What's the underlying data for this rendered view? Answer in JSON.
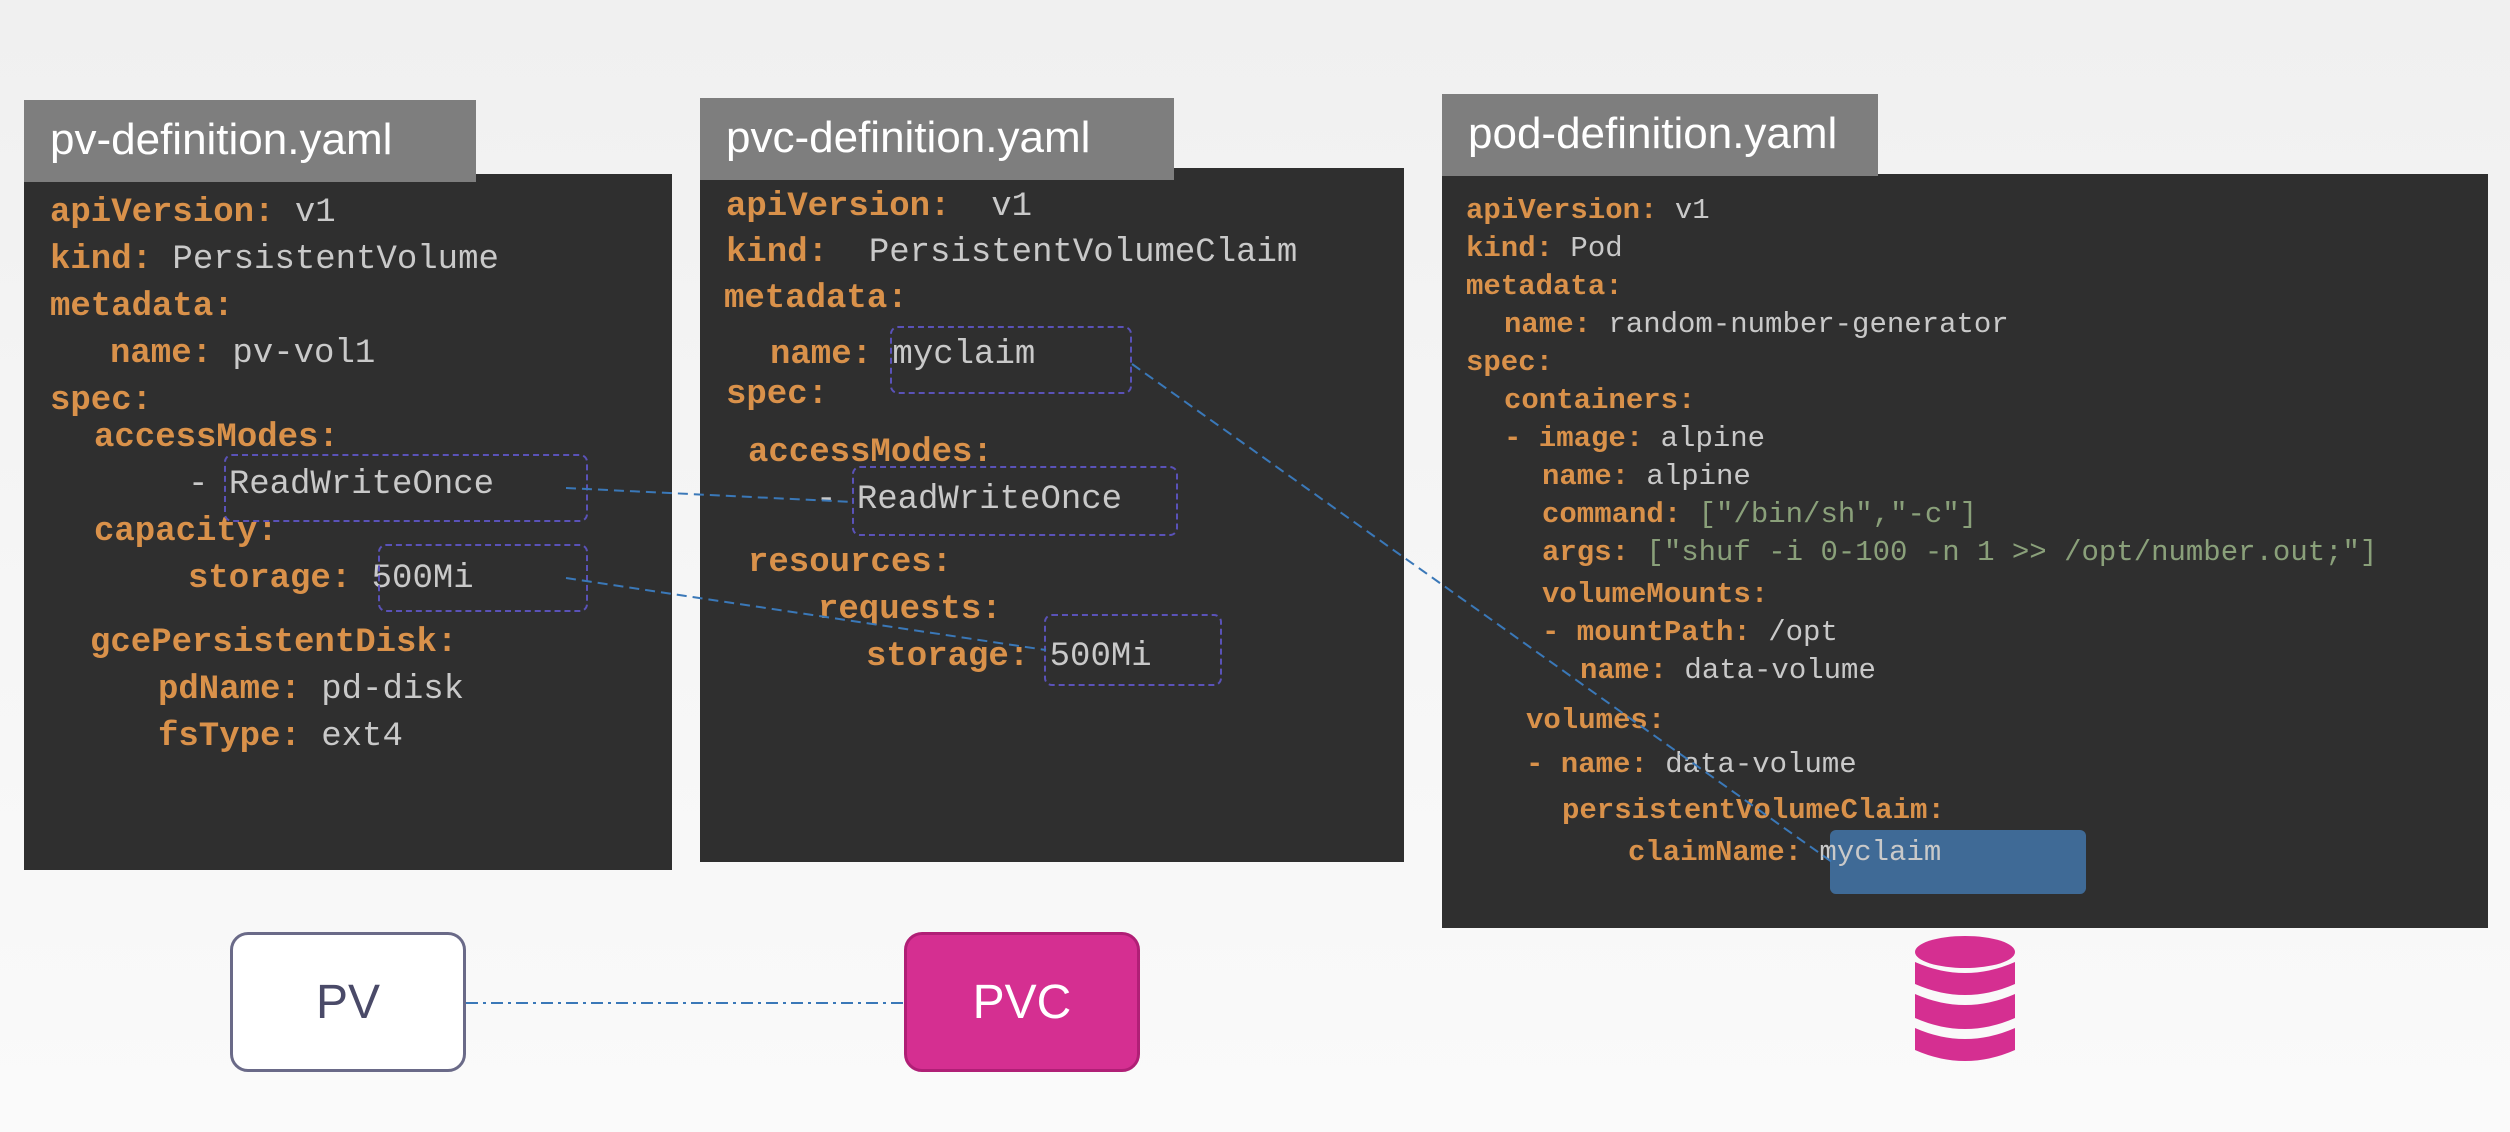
{
  "files": {
    "pv": {
      "title": "pv-definition.yaml",
      "lines": [
        [
          "apiVersion:",
          " v1"
        ],
        [
          "kind:",
          " PersistentVolume"
        ],
        [
          "metadata:",
          ""
        ],
        [
          "name:",
          " pv-vol1"
        ],
        [
          "spec:",
          ""
        ],
        [
          "accessModes:",
          ""
        ],
        [
          "- ",
          "ReadWriteOnce"
        ],
        [
          "capacity:",
          ""
        ],
        [
          "storage:",
          " 500Mi"
        ],
        [
          "gcePersistentDisk:",
          ""
        ],
        [
          "pdName:",
          " pd-disk"
        ],
        [
          "fsType:",
          " ext4"
        ]
      ]
    },
    "pvc": {
      "title": "pvc-definition.yaml",
      "lines": [
        [
          "apiVersion:",
          "  v1"
        ],
        [
          "kind:",
          "  PersistentVolumeClaim"
        ],
        [
          "metadata:",
          ""
        ],
        [
          "name:",
          " myclaim"
        ],
        [
          "spec:",
          ""
        ],
        [
          "accessModes:",
          ""
        ],
        [
          "- ",
          "ReadWriteOnce"
        ],
        [
          "resources:",
          ""
        ],
        [
          "requests:",
          ""
        ],
        [
          "storage:",
          " 500Mi"
        ]
      ]
    },
    "pod": {
      "title": "pod-definition.yaml",
      "lines": [
        [
          "apiVersion:",
          " v1"
        ],
        [
          "kind:",
          " Pod"
        ],
        [
          "metadata:",
          ""
        ],
        [
          "name:",
          " random-number-generator"
        ],
        [
          "spec:",
          ""
        ],
        [
          "containers:",
          ""
        ],
        [
          "- image:",
          " alpine"
        ],
        [
          "name:",
          " alpine"
        ],
        [
          "command:",
          " [\"/bin/sh\",\"-c\"]"
        ],
        [
          "args:",
          " [\"shuf -i 0-100 -n 1 >> /opt/number.out;\"]"
        ],
        [
          "volumeMounts:",
          ""
        ],
        [
          "- mountPath:",
          " /opt"
        ],
        [
          "name:",
          " data-volume"
        ],
        [
          "volumes:",
          ""
        ],
        [
          "- name:",
          " data-volume"
        ],
        [
          "persistentVolumeClaim:",
          ""
        ],
        [
          "claimName:",
          " myclaim"
        ]
      ]
    }
  },
  "nodes": {
    "pv_label": "PV",
    "pvc_label": "PVC",
    "pvc_color": "#d52f91",
    "storage_icon": "database-icon"
  },
  "colors": {
    "key": "#d9914a",
    "value": "#c9c9c9",
    "string": "#8aa07a",
    "panel": "#2f2f2f",
    "tab": "#7e7e7e",
    "link": "#3a78b8",
    "highlight_border": "#5a52b8",
    "highlight_fill": "#3f6a96"
  }
}
